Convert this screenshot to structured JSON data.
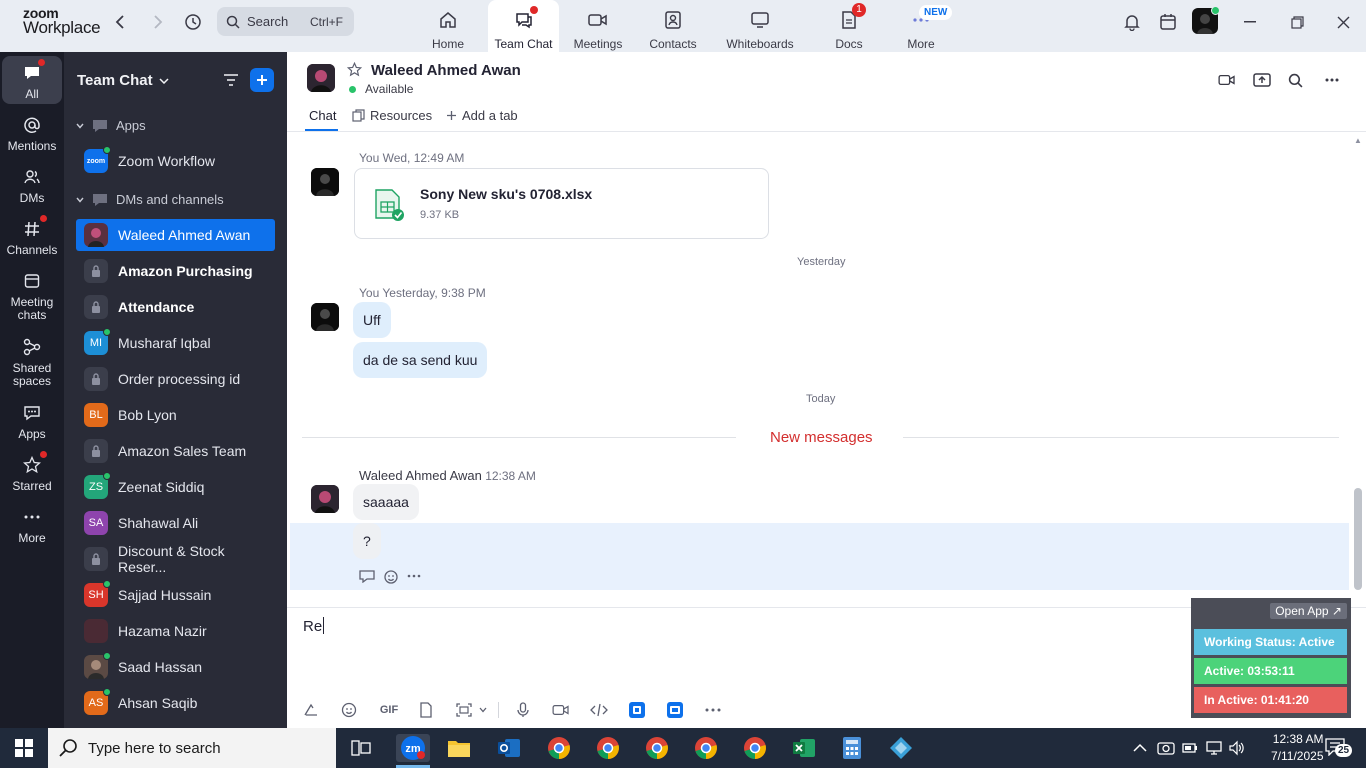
{
  "app": {
    "logo_line1": "zoom",
    "logo_line2": "Workplace"
  },
  "search": {
    "placeholder": "Search",
    "shortcut": "Ctrl+F"
  },
  "tabs": [
    {
      "label": "Home"
    },
    {
      "label": "Team Chat"
    },
    {
      "label": "Meetings"
    },
    {
      "label": "Contacts"
    },
    {
      "label": "Whiteboards"
    },
    {
      "label": "Docs",
      "badge": "1"
    },
    {
      "label": "More",
      "badge": "NEW"
    }
  ],
  "rail": [
    {
      "label": "All"
    },
    {
      "label": "Mentions"
    },
    {
      "label": "DMs"
    },
    {
      "label": "Channels"
    },
    {
      "label": "Meeting chats"
    },
    {
      "label": "Shared spaces"
    },
    {
      "label": "Apps"
    },
    {
      "label": "Starred"
    },
    {
      "label": "More"
    }
  ],
  "sidebar": {
    "title": "Team Chat",
    "sections": {
      "apps": "Apps",
      "dms": "DMs and channels"
    },
    "items": [
      {
        "label": "Zoom Workflow",
        "initials": "zoom"
      },
      {
        "label": "Waleed Ahmed Awan"
      },
      {
        "label": "Amazon Purchasing"
      },
      {
        "label": "Attendance"
      },
      {
        "label": "Musharaf Iqbal",
        "initials": "MI"
      },
      {
        "label": "Order processing id"
      },
      {
        "label": "Bob Lyon",
        "initials": "BL"
      },
      {
        "label": "Amazon Sales Team"
      },
      {
        "label": "Zeenat Siddiq",
        "initials": "ZS"
      },
      {
        "label": "Shahawal Ali",
        "initials": "SA"
      },
      {
        "label": "Discount & Stock Reser..."
      },
      {
        "label": "Sajjad Hussain",
        "initials": "SH"
      },
      {
        "label": "Hazama Nazir"
      },
      {
        "label": "Saad Hassan"
      },
      {
        "label": "Ahsan Saqib",
        "initials": "AS"
      }
    ]
  },
  "chat": {
    "contact": "Waleed Ahmed Awan",
    "status": "Available",
    "tabs": {
      "chat": "Chat",
      "resources": "Resources",
      "add": "Add a tab"
    },
    "messages": {
      "m1_meta": "You Wed, 12:49 AM",
      "file_name": "Sony New sku's 0708.xlsx",
      "file_size": "9.37 KB",
      "sep_yesterday": "Yesterday",
      "m2_meta": "You Yesterday, 9:38 PM",
      "m2_b1": "Uff",
      "m2_b2": "da de sa send kuu",
      "sep_today": "Today",
      "new_messages": "New messages",
      "m3_sender": "Waleed Ahmed Awan",
      "m3_time": "12:38 AM",
      "m3_b1": "saaaaa",
      "m3_b2": "?"
    },
    "composer_text": "Re",
    "gif_label": "GIF"
  },
  "widget": {
    "open_app": "Open App ↗",
    "working": "Working Status: Active",
    "active": "Active: 03:53:11",
    "inactive": "In Active: 01:41:20"
  },
  "taskbar": {
    "search_placeholder": "Type here to search",
    "time": "12:38 AM",
    "date": "7/11/2025",
    "notif_count": "25"
  },
  "colors": {
    "accent": "#0e71eb",
    "sidebar_bg": "#292b37",
    "rail_bg": "#1a1c27",
    "online": "#29c36a",
    "alert": "#e02828",
    "working_row": "#5bc0de",
    "active_row": "#4cd37a",
    "inactive_row": "#e8605e"
  }
}
